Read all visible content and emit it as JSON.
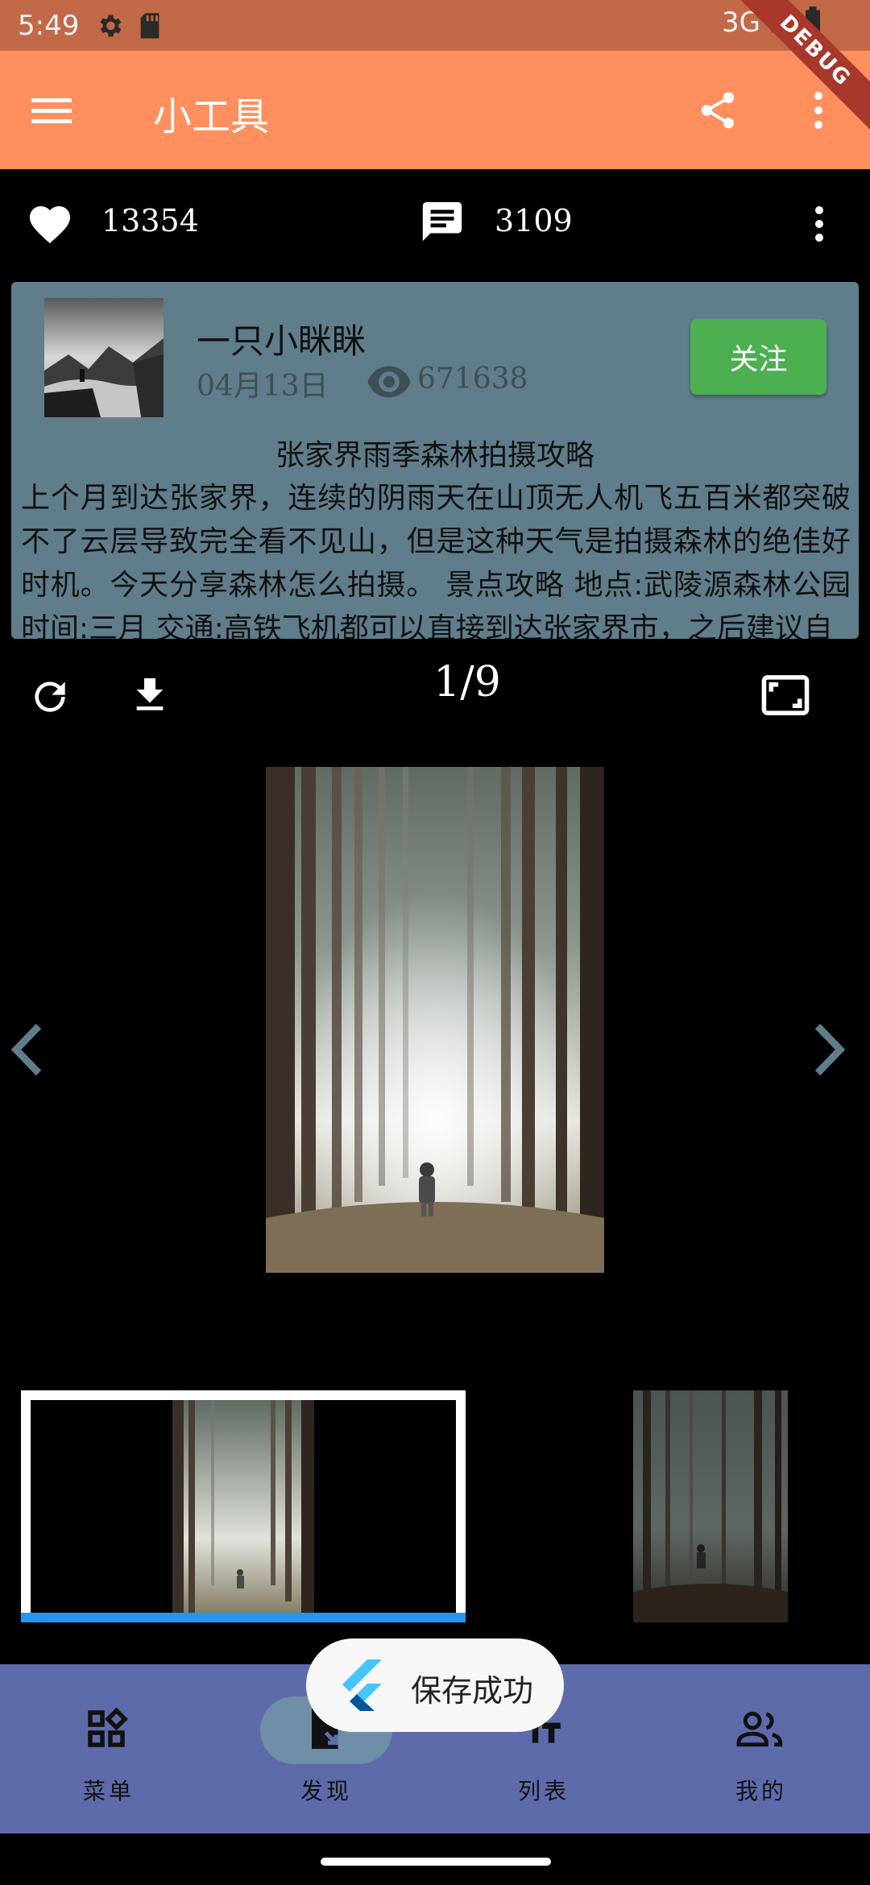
{
  "status_bar": {
    "time": "5:49",
    "network": "3G"
  },
  "debug_banner": "DEBUG",
  "app_bar": {
    "title": "小工具"
  },
  "stats": {
    "likes": "13354",
    "comments": "3109"
  },
  "post": {
    "author": "一只小眯眯",
    "date": "04月13日",
    "views": "671638",
    "follow_label": "关注",
    "title": "张家界雨季森林拍摄攻略",
    "body": "上个月到达张家界，连续的阴雨天在山顶无人机飞五百米都突破不了云层导致完全看不见山，但是这种天气是拍摄森林的绝佳好时机。今天分享森林怎么拍摄。 景点攻略 地点:武陵源森林公园 时间:三月 交通:高铁飞机都可以直接到达张家界市，之后建议自"
  },
  "viewer": {
    "page_indicator": "1/9"
  },
  "toast": {
    "message": "保存成功"
  },
  "bottom_nav": {
    "items": [
      {
        "label": "菜单",
        "icon": "widgets-icon"
      },
      {
        "label": "发现",
        "icon": "discover-icon",
        "active": true
      },
      {
        "label": "列表",
        "icon": "text-fields-icon"
      },
      {
        "label": "我的",
        "icon": "people-icon"
      }
    ]
  },
  "colors": {
    "status_bar": "#c26a48",
    "app_bar": "#ff8f5e",
    "card_bg": "#607d8b",
    "follow_button": "#4caf50",
    "bottom_nav": "#5e6bab",
    "thumb_progress": "#2196f3"
  }
}
